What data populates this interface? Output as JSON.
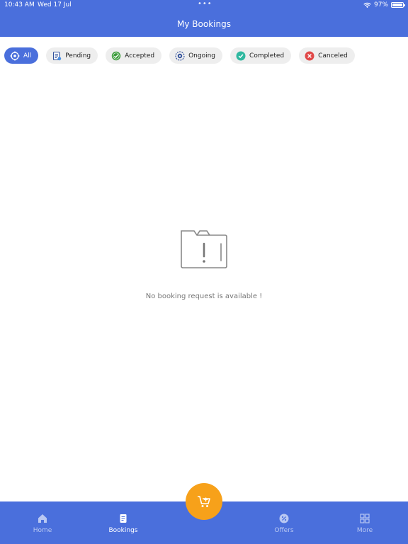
{
  "status_bar": {
    "time": "10:43 AM",
    "date": "Wed 17 Jul",
    "dots": "•••",
    "battery": "97%",
    "battery_level": 0.97
  },
  "header": {
    "title": "My Bookings"
  },
  "filters": [
    {
      "label": "All",
      "icon": "target-icon",
      "active": true
    },
    {
      "label": "Pending",
      "icon": "clipboard-icon",
      "active": false
    },
    {
      "label": "Accepted",
      "icon": "check-circle-icon",
      "active": false
    },
    {
      "label": "Ongoing",
      "icon": "gear-icon",
      "active": false
    },
    {
      "label": "Completed",
      "icon": "check-circle-icon",
      "active": false
    },
    {
      "label": "Canceled",
      "icon": "x-circle-icon",
      "active": false
    }
  ],
  "empty_state": {
    "icon": "folder-alert-icon",
    "message": "No booking request is available !"
  },
  "bottom_nav": [
    {
      "label": "Home",
      "icon": "home-icon",
      "active": false
    },
    {
      "label": "Bookings",
      "icon": "bookings-icon",
      "active": true
    },
    {
      "label": "Offers",
      "icon": "offer-icon",
      "active": false
    },
    {
      "label": "More",
      "icon": "grid-icon",
      "active": false
    }
  ],
  "fab": {
    "icon": "cart-icon"
  },
  "colors": {
    "primary": "#4a6fdc",
    "fab": "#f7a11a",
    "accepted": "#3a9a3a",
    "completed": "#2fb8a0",
    "canceled": "#e04848",
    "ongoing": "#2f4f9a"
  }
}
